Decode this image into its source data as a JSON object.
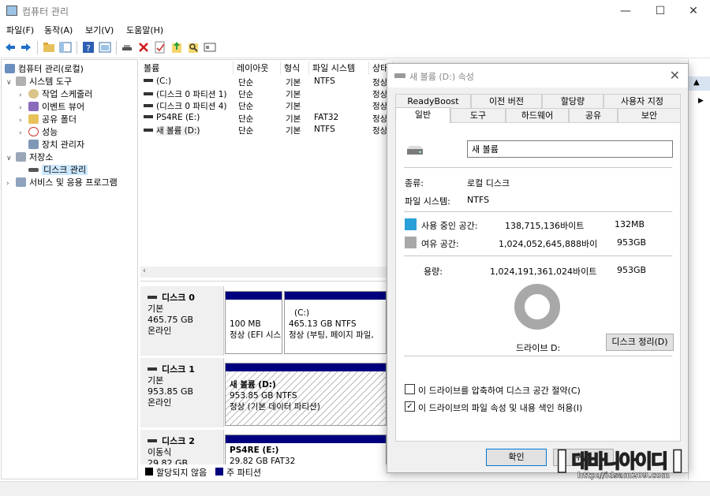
{
  "window": {
    "title": "컴퓨터 관리",
    "controls": {
      "minimize": "—",
      "maximize": "☐",
      "close": "✕"
    }
  },
  "menu": [
    "파일(F)",
    "동작(A)",
    "보기(V)",
    "도움말(H)"
  ],
  "toolbar_icons": [
    "back-icon",
    "forward-icon",
    "up-folder-icon",
    "show-hide-tree-icon",
    "help-icon",
    "console-icon",
    "connect-icon",
    "delete-icon",
    "properties-icon",
    "export-icon",
    "search-icon",
    "settings-icon"
  ],
  "tree": {
    "root": "컴퓨터 관리(로컬)",
    "items": [
      {
        "label": "시스템 도구",
        "level": 1,
        "expanded": true,
        "icon": "tools-icon"
      },
      {
        "label": "작업 스케줄러",
        "level": 2,
        "icon": "clock-icon"
      },
      {
        "label": "이벤트 뷰어",
        "level": 2,
        "icon": "event-viewer-icon"
      },
      {
        "label": "공유 폴더",
        "level": 2,
        "icon": "shared-folder-icon"
      },
      {
        "label": "성능",
        "level": 2,
        "icon": "performance-icon"
      },
      {
        "label": "장치 관리자",
        "level": 2,
        "icon": "device-manager-icon"
      },
      {
        "label": "저장소",
        "level": 1,
        "expanded": true,
        "icon": "storage-icon"
      },
      {
        "label": "디스크 관리",
        "level": 2,
        "selected": true,
        "icon": "disk-icon"
      },
      {
        "label": "서비스 및 응용 프로그램",
        "level": 1,
        "icon": "services-icon"
      }
    ]
  },
  "volumes": {
    "columns": [
      "볼륨",
      "레이아웃",
      "형식",
      "파일 시스템",
      "상태"
    ],
    "rows": [
      [
        "(C:)",
        "단순",
        "기본",
        "NTFS",
        "정상"
      ],
      [
        "(디스크 0 파티션 1)",
        "단순",
        "기본",
        "",
        "정상"
      ],
      [
        "(디스크 0 파티션 4)",
        "단순",
        "기본",
        "",
        "정상"
      ],
      [
        "PS4RE (E:)",
        "단순",
        "기본",
        "FAT32",
        "정상"
      ],
      [
        "새 볼륨 (D:)",
        "단순",
        "기본",
        "NTFS",
        "정상"
      ]
    ]
  },
  "disks": [
    {
      "name": "디스크 0",
      "type": "기본",
      "size": "465.75 GB",
      "status": "온라인",
      "partitions": [
        {
          "title": "",
          "line1": "100 MB",
          "line2": "정상 (EFI 시스",
          "hatched": false
        },
        {
          "title": "(C:)",
          "line1": "465.13 GB NTFS",
          "line2": "정상 (부팅, 페이지 파일,",
          "hatched": false
        }
      ]
    },
    {
      "name": "디스크 1",
      "type": "기본",
      "size": "953.85 GB",
      "status": "온라인",
      "partitions": [
        {
          "title": "새 볼륨  (D:)",
          "line1": "953.85 GB NTFS",
          "line2": "정상 (기본 데이터 파티션)",
          "hatched": true
        }
      ]
    },
    {
      "name": "디스크 2",
      "type": "이동식",
      "size": "29.82 GB",
      "status": "",
      "partitions": [
        {
          "title": "PS4RE  (E:)",
          "line1": "29.82 GB FAT32",
          "line2": "",
          "hatched": false
        }
      ]
    }
  ],
  "legend": [
    {
      "label": "할당되지 않음",
      "color": "#000000"
    },
    {
      "label": "주 파티션",
      "color": "#00007f"
    }
  ],
  "dialog": {
    "title": "새 볼륨 (D:) 속성",
    "tabs_row1": [
      "ReadyBoost",
      "이전 버전",
      "할당량",
      "사용자 지정"
    ],
    "tabs_row2": [
      "일반",
      "도구",
      "하드웨어",
      "공유",
      "보안"
    ],
    "active_tab": "일반",
    "volume_name": "새 볼륨",
    "type_label": "종류:",
    "type_value": "로컬 디스크",
    "fs_label": "파일 시스템:",
    "fs_value": "NTFS",
    "used_label": "사용 중인 공간:",
    "used_bytes": "138,715,136바이트",
    "used_size": "132MB",
    "used_color": "#2a9fd8",
    "free_label": "여유 공간:",
    "free_bytes": "1,024,052,645,888바이",
    "free_size": "953GB",
    "free_color": "#a8a8a8",
    "capacity_label": "용량:",
    "capacity_bytes": "1,024,191,361,024바이트",
    "capacity_size": "953GB",
    "drive_label": "드라이브 D:",
    "cleanup_button": "디스크 정리(D)",
    "compress_label": "이 드라이브를 압축하여 디스크 공간 절약(C)",
    "compress_checked": false,
    "index_label": "이 드라이브의 파일 속성 및 내용 색인 허용(I)",
    "index_checked": true,
    "ok_button": "확인",
    "cancel_button": "취소"
  },
  "watermark": {
    "text": "대바니아이디",
    "url": "http://idsam209.com"
  }
}
